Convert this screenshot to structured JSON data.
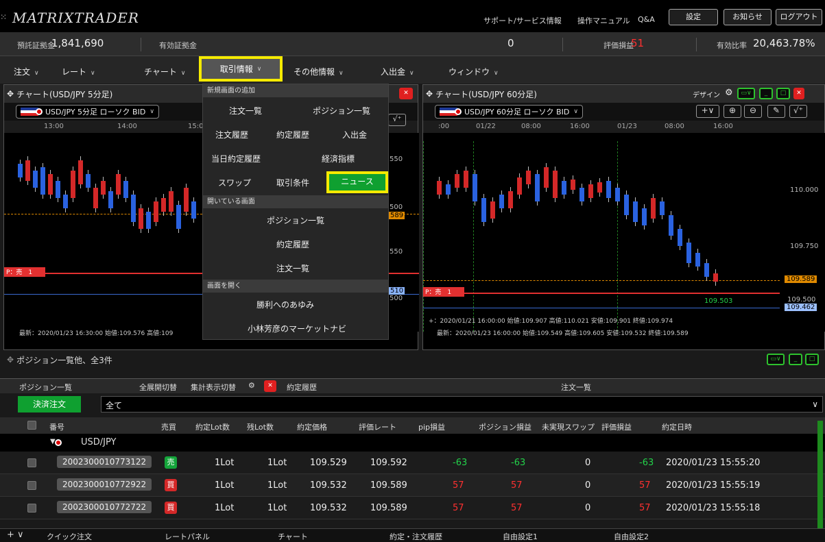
{
  "app": {
    "title": "MATRIXTRADER"
  },
  "top_links": {
    "support": "サポート/サービス情報",
    "manual": "操作マニュアル",
    "qa": "Q&A"
  },
  "top_buttons": {
    "settings": "設定",
    "notice": "お知らせ",
    "logout": "ログアウト"
  },
  "account": {
    "deposit_label": "預託証拠金",
    "deposit_value": "1,841,690",
    "effective_label": "有効証拠金",
    "required_value": "0",
    "pl_label": "評価損益",
    "pl_value": "51",
    "ratio_label": "有効比率",
    "ratio_value": "20,463.78%"
  },
  "menu": {
    "order": "注文",
    "rate": "レート",
    "chart": "チャート",
    "trade_info": "取引情報",
    "other": "その他情報",
    "deposit": "入出金",
    "window": "ウィンドウ"
  },
  "dropdown": {
    "sec_new": "新規画面の追加",
    "order_list": "注文一覧",
    "position_list": "ポジション一覧",
    "order_history": "注文履歴",
    "exec_history": "約定履歴",
    "deposit": "入出金",
    "today_exec": "当日約定履歴",
    "econ": "経済指標",
    "swap": "スワップ",
    "conditions": "取引条件",
    "news": "ニュース",
    "sec_open": "開いている画面",
    "open_position": "ポジション一覧",
    "open_exec": "約定履歴",
    "open_order": "注文一覧",
    "sec_screen": "画面を開く",
    "victory": "勝利へのあゆみ",
    "kobayashi": "小林芳彦のマーケットナビ"
  },
  "chart1": {
    "title": "チャート(USD/JPY 5分足)",
    "symbol": "USD/JPY 5分足 ローソク BID",
    "times": [
      "13:00",
      "14:00",
      "15:0"
    ],
    "prices": [
      "550",
      "500",
      "589",
      "550",
      "510",
      "500"
    ],
    "position_label": "P：売　1",
    "info": "最新：2020/01/23 16:30:00 始値:109.576 高値:109"
  },
  "chart2": {
    "title": "チャート(USD/JPY 60分足)",
    "design": "デザイン",
    "symbol": "USD/JPY 60分足 ローソク BID",
    "times": [
      ":00",
      "01/22",
      "08:00",
      "16:00",
      "01/23",
      "08:00",
      "16:00"
    ],
    "prices": [
      "110.000",
      "109.750",
      "109.589",
      "109.500",
      "109.462"
    ],
    "low_label": "109.503",
    "position_label": "P：売　1",
    "info1": "+：2020/01/21 16:00:00 始値:109.907 高値:110.021 安値:109.901 終値:109.974",
    "info2": "最新：2020/01/23 16:00:00 始値:109.549 高値:109.605 安値:109.532 終値:109.589"
  },
  "positions": {
    "title": "ポジション一覧他、全3件",
    "tab1": "ポジション一覧",
    "expand": "全展開切替",
    "summary": "集計表示切替",
    "tab2": "約定履歴",
    "tab3": "注文一覧",
    "settle_btn": "決済注文",
    "filter": "全て",
    "headers": [
      "番号",
      "売買",
      "約定Lot数",
      "残Lot数",
      "約定価格",
      "評価レート",
      "pip損益",
      "ポジション損益",
      "未実現スワップ",
      "評価損益",
      "約定日時"
    ],
    "group": "USD/JPY",
    "rows": [
      {
        "id": "2002300010773122",
        "side": "売",
        "lot": "1Lot",
        "remain": "1Lot",
        "price": "109.529",
        "rate": "109.592",
        "pip": "-63",
        "pos_pl": "-63",
        "swap": "0",
        "pl": "-63",
        "time": "2020/01/23 15:55:20"
      },
      {
        "id": "2002300010772922",
        "side": "買",
        "lot": "1Lot",
        "remain": "1Lot",
        "price": "109.532",
        "rate": "109.589",
        "pip": "57",
        "pos_pl": "57",
        "swap": "0",
        "pl": "57",
        "time": "2020/01/23 15:55:19"
      },
      {
        "id": "2002300010772722",
        "side": "買",
        "lot": "1Lot",
        "remain": "1Lot",
        "price": "109.532",
        "rate": "109.589",
        "pip": "57",
        "pos_pl": "57",
        "swap": "0",
        "pl": "57",
        "time": "2020/01/23 15:55:18"
      }
    ]
  },
  "footer": {
    "quick": "クイック注文",
    "ratepanel": "レートパネル",
    "chart": "チャート",
    "exec": "約定・注文履歴",
    "custom1": "自由設定1",
    "custom2": "自由設定2"
  },
  "colors": {
    "highlight": "#f5ea00",
    "up": "#d42828",
    "down": "#2a62e0",
    "green": "#23d24a"
  }
}
